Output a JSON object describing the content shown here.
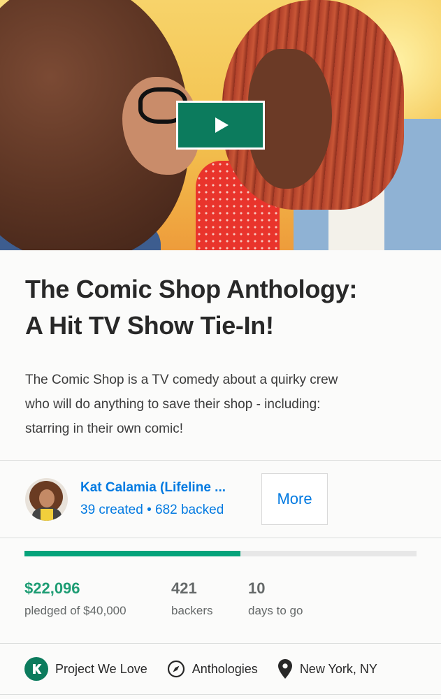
{
  "video": {
    "play_label": "Play video"
  },
  "project": {
    "title_line1": "The Comic Shop Anthology:",
    "title_line2": "A Hit TV Show Tie-In!",
    "blurb_line1": "The Comic Shop is a TV comedy about a quirky crew",
    "blurb_line2": "who will do anything to save their shop - including:",
    "blurb_line3": "starring in their own comic!"
  },
  "creator": {
    "name": "Kat Calamia (Lifeline ...",
    "created": "39 created",
    "separator": "•",
    "backed": "682 backed",
    "more_label": "More"
  },
  "funding": {
    "progress_fraction": 0.55,
    "pledged_amount": "$22,096",
    "pledged_label": "pledged of $40,000",
    "backers_count": "421",
    "backers_label": "backers",
    "days_count": "10",
    "days_label": "days to go"
  },
  "tags": {
    "pwl_label": "Project We Love",
    "category_label": "Anthologies",
    "location_label": "New York, NY"
  },
  "colors": {
    "link_blue": "#037ae1",
    "funded_green": "#05a37a",
    "play_button_green": "#0c7b5d"
  }
}
